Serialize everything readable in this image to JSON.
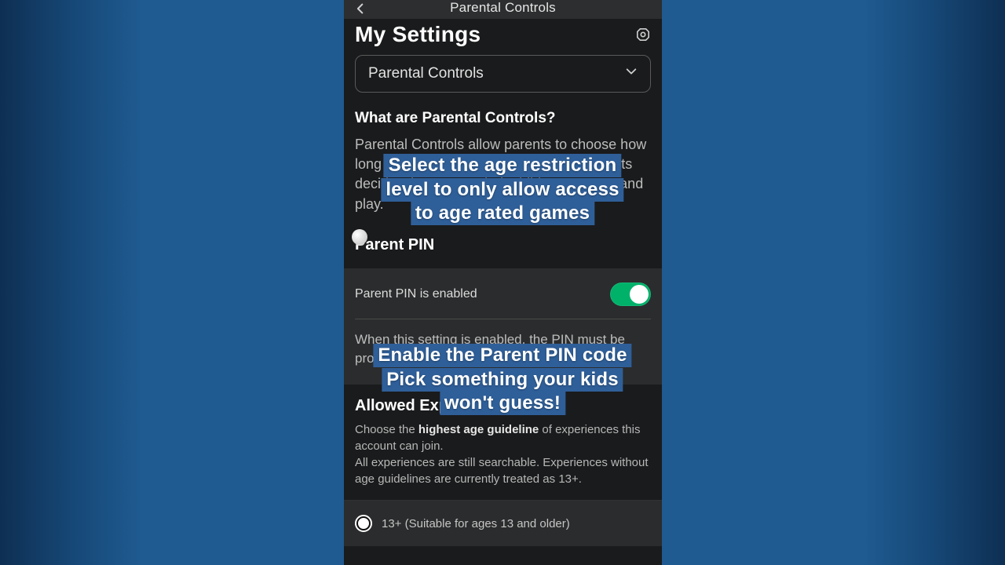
{
  "navbar": {
    "title": "Parental Controls"
  },
  "page": {
    "heading": "My Settings",
    "dropdown_label": "Parental Controls",
    "what_title": "What are Parental Controls?",
    "what_desc": "Parental Controls allow parents to choose how long their child will continue playing. Parents decide what games their child can access and play.",
    "parent_pin_title": "Parent PIN",
    "parent_pin_toggle_label": "Parent PIN is enabled",
    "parent_pin_desc": "When this setting is enabled, the PIN must be provided to make changes to settings.",
    "allowed_title": "Allowed Experiences",
    "allowed_desc_prefix": "Choose the ",
    "allowed_desc_bold": "highest age guideline",
    "allowed_desc_suffix": " of experiences this account can join.\nAll experiences are still searchable. Experiences without age guidelines are currently treated as 13+.",
    "option_13": "13+ (Suitable for ages 13 and older)"
  },
  "captions": {
    "top": "Select the age restriction\nlevel to only allow access\nto age rated games",
    "mid": "Enable the Parent PIN code\nPick something your kids\nwon't guess!"
  }
}
